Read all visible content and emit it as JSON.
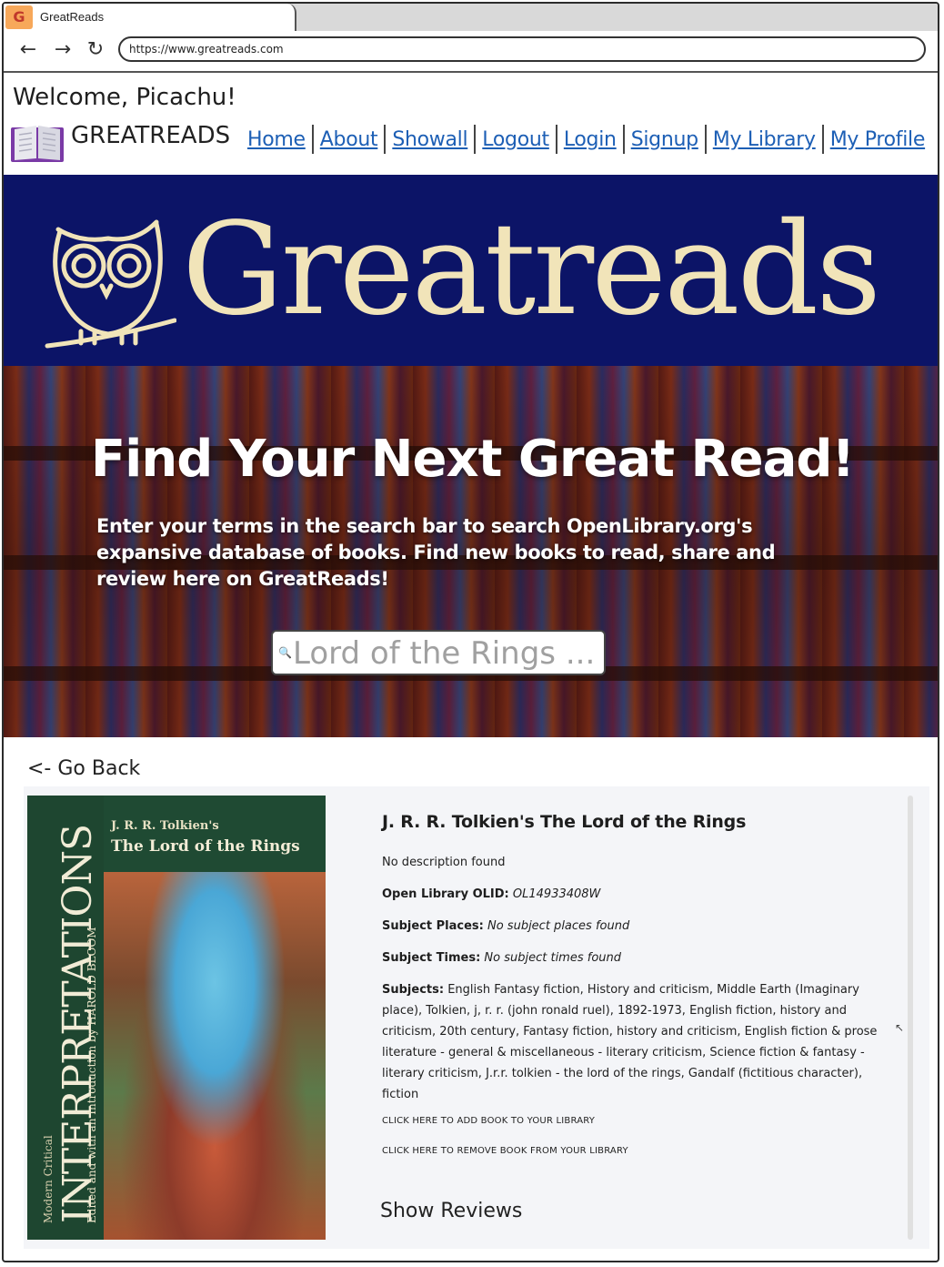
{
  "browser": {
    "tab_title": "GreatReads",
    "favicon_letter": "G",
    "url": "https://www.greatreads.com"
  },
  "header": {
    "welcome": "Welcome, Picachu!",
    "brand": "GREATREADS",
    "nav": {
      "home": "Home",
      "about": "About",
      "showall": "Showall",
      "logout": "Logout",
      "login": "Login",
      "signup": "Signup",
      "my_library": "My Library",
      "my_profile": "My Profile"
    }
  },
  "banner": {
    "title": "Greatreads",
    "bg_color": "#0c1467",
    "text_color": "#f1e4b9"
  },
  "hero": {
    "title": "Find Your Next Great Read!",
    "subtitle": "Enter your terms in the search bar to search OpenLibrary.org's expansive database of books.  Find new books to read, share and review here on GreatReads!",
    "search_placeholder": "Lord of the Rings ..."
  },
  "details": {
    "go_back": "<- Go Back",
    "cover": {
      "kicker": "J. R. R. Tolkien's",
      "title": "The Lord of the Rings",
      "series": "Modern Critical",
      "main": "INTERPRETATIONS",
      "editor": "Edited and with an Introduction by HAROLD BLOOM"
    },
    "title": "J. R. R. Tolkien's The Lord of the Rings",
    "description": "No description found",
    "olid_label": "Open Library OLID:",
    "olid_value": "OL14933408W",
    "places_label": "Subject Places:",
    "places_value": "No subject places found",
    "times_label": "Subject Times:",
    "times_value": "No subject times found",
    "subjects_label": "Subjects:",
    "subjects_value": "English Fantasy fiction, History and criticism, Middle Earth (Imaginary place), Tolkien, j, r. r. (john ronald ruel), 1892-1973, English fiction, history and criticism, 20th century, Fantasy fiction, history and criticism, English fiction & prose literature - general & miscellaneous - literary criticism, Science fiction & fantasy - literary criticism, J.r.r. tolkien - the lord of the rings, Gandalf (fictitious character), fiction",
    "add_action": "Click here to add book to your library",
    "remove_action": "Click here to remove book from your library",
    "show_reviews": "Show Reviews"
  }
}
